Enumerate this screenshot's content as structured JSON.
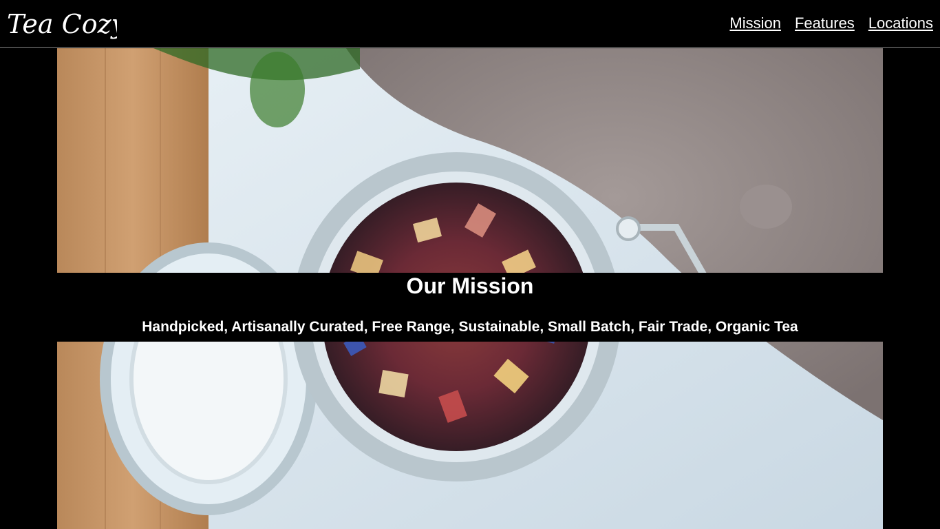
{
  "header": {
    "logo_text": "Tea Cozy",
    "nav": [
      {
        "label": "Mission"
      },
      {
        "label": "Features"
      },
      {
        "label": "Locations"
      }
    ]
  },
  "hero": {
    "image_icon": "tea-jar-photo"
  },
  "mission": {
    "title": "Our Mission",
    "subtitle": "Handpicked, Artisanally Curated, Free Range, Sustainable, Small Batch, Fair Trade, Organic Tea"
  },
  "colors": {
    "background": "#000000",
    "text": "#ffffff",
    "header_border": "#8a8a8a"
  }
}
